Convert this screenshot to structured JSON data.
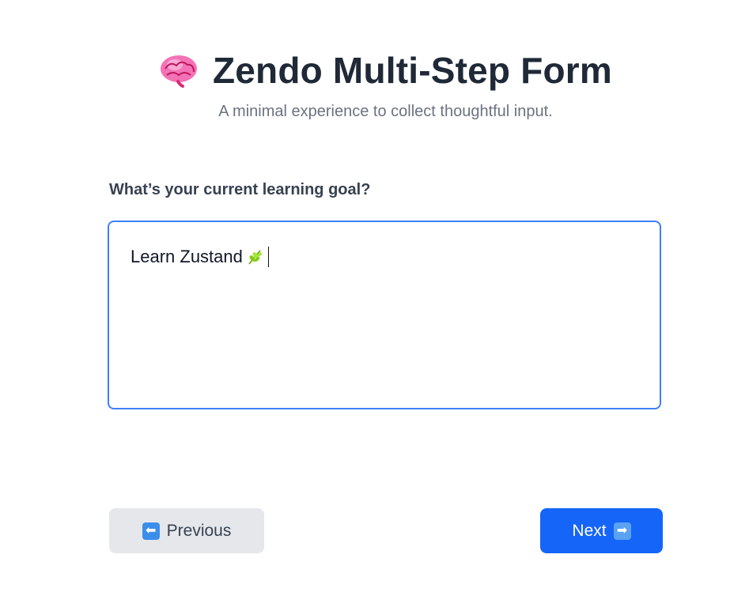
{
  "header": {
    "title": "Zendo Multi-Step Form",
    "subtitle": "A minimal experience to collect thoughtful input.",
    "icon": "brain-icon"
  },
  "step": {
    "question": "What’s your current learning goal?",
    "answer": "Learn Zustand",
    "answer_icon": "herb-icon"
  },
  "nav": {
    "previous_label": "Previous",
    "previous_icon": "left-arrow-icon",
    "next_label": "Next",
    "next_icon": "right-arrow-icon"
  },
  "colors": {
    "primary": "#1565f8",
    "focus_border": "#3b82f6",
    "secondary_bg": "#e5e7eb",
    "title": "#1f2937",
    "subtitle": "#6b7280"
  }
}
